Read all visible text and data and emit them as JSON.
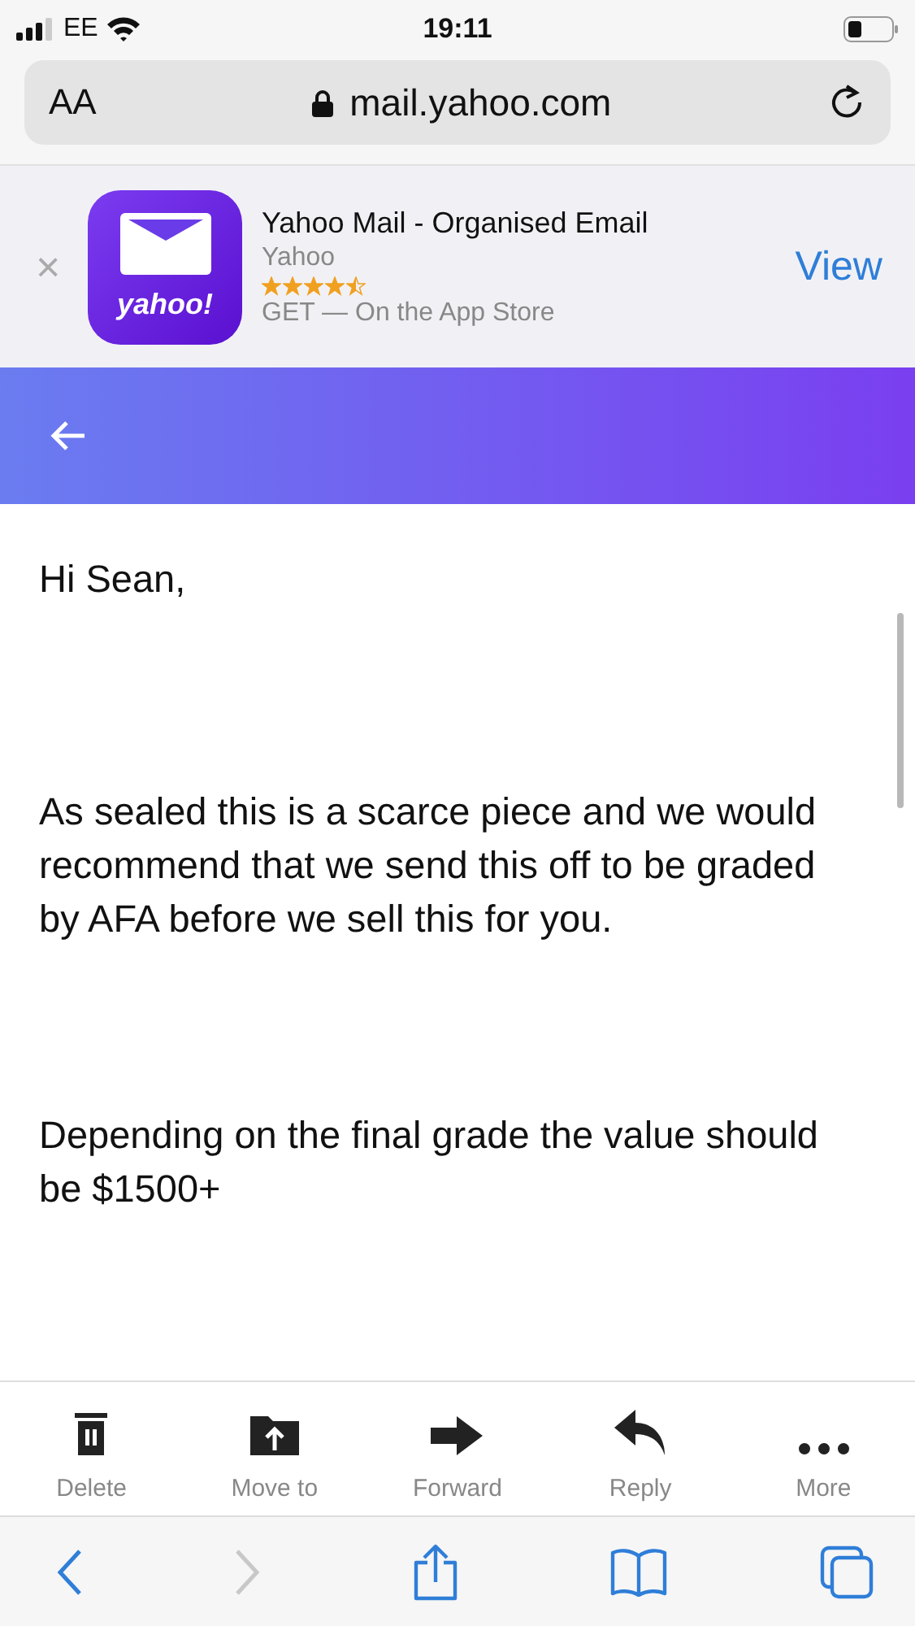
{
  "status_bar": {
    "carrier": "EE",
    "time": "19:11"
  },
  "address_bar": {
    "text_size_button": "AA",
    "url": "mail.yahoo.com"
  },
  "app_banner": {
    "title": "Yahoo Mail - Organised Email",
    "developer": "Yahoo",
    "stars": 4.5,
    "subtitle": "GET — On the App Store",
    "app_icon_text": "yahoo!",
    "close": "×",
    "action": "View"
  },
  "email": {
    "paragraphs": [
      "Hi Sean,",
      "As sealed this is a scarce piece and we would recommend that we send this off to be graded by AFA before we sell this for you.",
      "Depending on the final grade the value should be $1500+"
    ]
  },
  "actions": [
    {
      "kind": "delete",
      "label": "Delete"
    },
    {
      "kind": "move",
      "label": "Move to"
    },
    {
      "kind": "forward",
      "label": "Forward"
    },
    {
      "kind": "reply",
      "label": "Reply"
    },
    {
      "kind": "more",
      "label": "More"
    }
  ],
  "browser_toolbar": [
    {
      "kind": "back",
      "disabled": false
    },
    {
      "kind": "forward",
      "disabled": true
    },
    {
      "kind": "share",
      "disabled": false
    },
    {
      "kind": "bookmarks",
      "disabled": false
    },
    {
      "kind": "tabs",
      "disabled": false
    }
  ]
}
